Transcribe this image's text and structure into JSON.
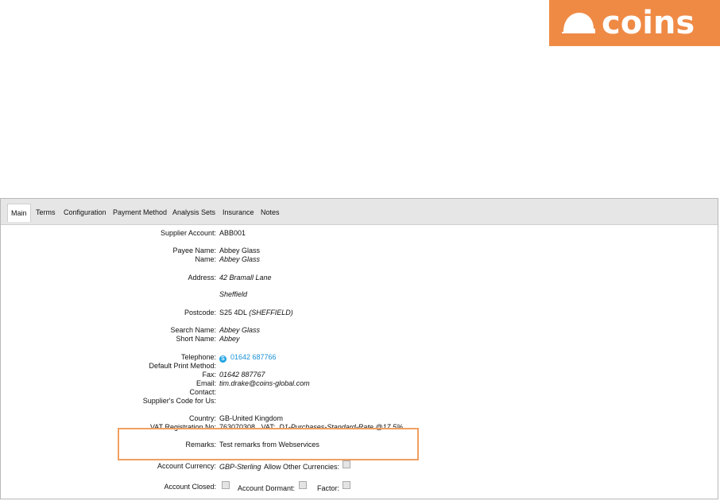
{
  "brand": {
    "logo_text": "coins",
    "color": "#ef8a45"
  },
  "tabs": [
    {
      "label": "Main",
      "active": true
    },
    {
      "label": "Terms"
    },
    {
      "label": "Configuration"
    },
    {
      "label": "Payment Method"
    },
    {
      "label": "Analysis Sets"
    },
    {
      "label": "Insurance"
    },
    {
      "label": "Notes"
    }
  ],
  "fields": {
    "supplier_account": {
      "label": "Supplier Account:",
      "value": "ABB001"
    },
    "payee_name": {
      "label": "Payee Name:",
      "value": "Abbey Glass"
    },
    "name": {
      "label": "Name:",
      "value": "Abbey Glass"
    },
    "address": {
      "label": "Address:",
      "line1": "42 Bramall Lane",
      "line2": "Sheffield"
    },
    "postcode": {
      "label": "Postcode:",
      "value": "S25 4DL",
      "extra": "(SHEFFIELD)"
    },
    "search_name": {
      "label": "Search Name:",
      "value": "Abbey Glass"
    },
    "short_name": {
      "label": "Short Name:",
      "value": "Abbey"
    },
    "telephone": {
      "label": "Telephone:",
      "value": "01642 687766"
    },
    "default_print_method": {
      "label": "Default Print Method:",
      "value": ""
    },
    "fax": {
      "label": "Fax:",
      "value": "01642 887767"
    },
    "email": {
      "label": "Email:",
      "value": "tim.drake@coins-global.com"
    },
    "contact": {
      "label": "Contact:",
      "value": ""
    },
    "suppliers_code": {
      "label": "Supplier's Code for Us:",
      "value": ""
    },
    "country": {
      "label": "Country:",
      "value": "GB-United Kingdom"
    },
    "vat": {
      "label": "VAT Registration No:",
      "value": "763070308",
      "code_label": "VAT:",
      "code_value": "D1-Purchases-Standard-Rate @17.5%"
    },
    "remarks": {
      "label": "Remarks:",
      "value": "Test remarks from Webservices"
    },
    "account_currency": {
      "label": "Account Currency:",
      "value": "GBP-Sterling",
      "allow_label": "Allow Other Currencies:"
    },
    "account_closed": {
      "label": "Account Closed:"
    },
    "account_dormant": {
      "label": "Account Dormant:"
    },
    "factor": {
      "label": "Factor:"
    }
  }
}
